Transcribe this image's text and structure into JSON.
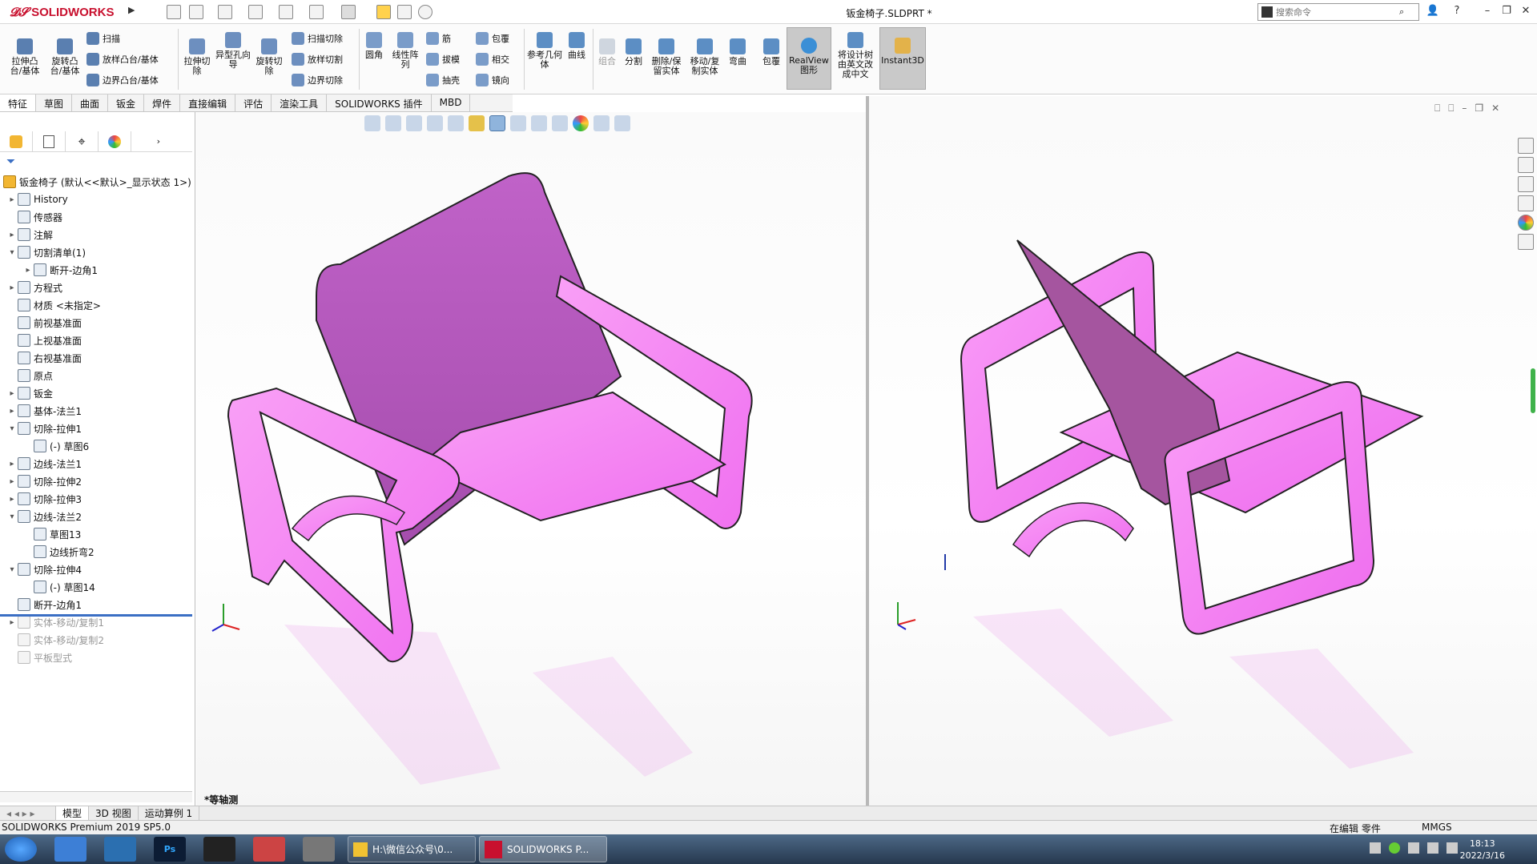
{
  "app": {
    "brand": "SOLIDWORKS",
    "document_title": "钣金椅子.SLDPRT *"
  },
  "search": {
    "placeholder": "搜索命令"
  },
  "commands": {
    "col1": [
      "拉伸凸台/基体",
      "旋转凸台/基体"
    ],
    "sweep": "扫描",
    "loft": "放样凸台/基体",
    "boundary": "边界凸台/基体",
    "col2": [
      "拉伸切除",
      "异型孔向导",
      "旋转切除"
    ],
    "sweep_cut": "扫描切除",
    "loft_cut": "放样切割",
    "boundary_cut": "边界切除",
    "fillet": "圆角",
    "linear_pattern": "线性阵列",
    "rib": "筋",
    "draft": "拔模",
    "shell": "抽壳",
    "wrap": "包覆",
    "intersect": "相交",
    "mirror": "镜向",
    "ref_geom": "参考几何体",
    "curves": "曲线",
    "combine": "组合",
    "split": "分割",
    "delete_body": "删除/保留实体",
    "move_copy": "移动/复制实体",
    "flex": "弯曲",
    "wrap2": "包覆",
    "realview": "RealView图形",
    "translate_tree": "将设计树由英文改成中文",
    "instant3d": "Instant3D"
  },
  "tabs": [
    "特征",
    "草图",
    "曲面",
    "钣金",
    "焊件",
    "直接编辑",
    "评估",
    "渲染工具",
    "SOLIDWORKS 插件",
    "MBD"
  ],
  "tree": {
    "root": "钣金椅子 (默认<<默认>_显示状态 1>)",
    "items": [
      {
        "label": "History",
        "indent": 1,
        "arrow": "▸",
        "grey": false
      },
      {
        "label": "传感器",
        "indent": 1,
        "arrow": "",
        "grey": false
      },
      {
        "label": "注解",
        "indent": 1,
        "arrow": "▸",
        "grey": false
      },
      {
        "label": "切割清单(1)",
        "indent": 1,
        "arrow": "▾",
        "grey": false
      },
      {
        "label": "断开-边角1",
        "indent": 2,
        "arrow": "▸",
        "grey": false
      },
      {
        "label": "方程式",
        "indent": 1,
        "arrow": "▸",
        "grey": false
      },
      {
        "label": "材质 <未指定>",
        "indent": 1,
        "arrow": "",
        "grey": false
      },
      {
        "label": "前视基准面",
        "indent": 1,
        "arrow": "",
        "grey": false
      },
      {
        "label": "上视基准面",
        "indent": 1,
        "arrow": "",
        "grey": false
      },
      {
        "label": "右视基准面",
        "indent": 1,
        "arrow": "",
        "grey": false
      },
      {
        "label": "原点",
        "indent": 1,
        "arrow": "",
        "grey": false
      },
      {
        "label": "钣金",
        "indent": 1,
        "arrow": "▸",
        "grey": false
      },
      {
        "label": "基体-法兰1",
        "indent": 1,
        "arrow": "▸",
        "grey": false
      },
      {
        "label": "切除-拉伸1",
        "indent": 1,
        "arrow": "▾",
        "grey": false
      },
      {
        "label": "(-) 草图6",
        "indent": 2,
        "arrow": "",
        "grey": false
      },
      {
        "label": "边线-法兰1",
        "indent": 1,
        "arrow": "▸",
        "grey": false
      },
      {
        "label": "切除-拉伸2",
        "indent": 1,
        "arrow": "▸",
        "grey": false
      },
      {
        "label": "切除-拉伸3",
        "indent": 1,
        "arrow": "▸",
        "grey": false
      },
      {
        "label": "边线-法兰2",
        "indent": 1,
        "arrow": "▾",
        "grey": false
      },
      {
        "label": "草图13",
        "indent": 2,
        "arrow": "",
        "grey": false
      },
      {
        "label": "边线折弯2",
        "indent": 2,
        "arrow": "",
        "grey": false
      },
      {
        "label": "切除-拉伸4",
        "indent": 1,
        "arrow": "▾",
        "grey": false
      },
      {
        "label": "(-) 草图14",
        "indent": 2,
        "arrow": "",
        "grey": false
      },
      {
        "label": "断开-边角1",
        "indent": 1,
        "arrow": "",
        "grey": false
      },
      {
        "label": "实体-移动/复制1",
        "indent": 1,
        "arrow": "▸",
        "grey": true
      },
      {
        "label": "实体-移动/复制2",
        "indent": 1,
        "arrow": "",
        "grey": true
      },
      {
        "label": "平板型式",
        "indent": 1,
        "arrow": "",
        "grey": true
      }
    ]
  },
  "viewport": {
    "view_name": "*等轴测"
  },
  "bottom_tabs": [
    "模型",
    "3D 视图",
    "运动算例 1"
  ],
  "status": {
    "product": "SOLIDWORKS Premium 2019 SP5.0",
    "mode": "在编辑 零件",
    "units": "MMGS"
  },
  "taskbar": {
    "task1": "H:\\微信公众号\\0...",
    "task2": "SOLIDWORKS P...",
    "time": "18:13",
    "date": "2022/3/16"
  },
  "colors": {
    "part": "#f070f0",
    "part_dark": "#b04fb8",
    "accent": "#c8102e"
  }
}
